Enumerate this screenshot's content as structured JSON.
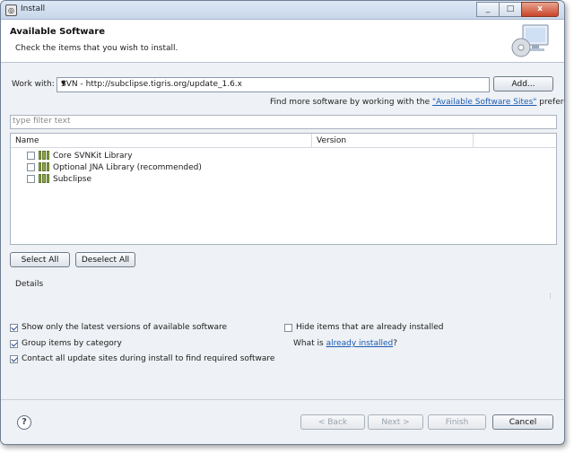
{
  "window": {
    "title": "Install",
    "icon": "eclipse-install-icon",
    "controls": {
      "minimize": "_",
      "maximize": "□",
      "close": "x"
    }
  },
  "header": {
    "title": "Available Software",
    "subtitle": "Check the items that you wish to install."
  },
  "work_with": {
    "label": "Work with:",
    "value": "SVN - http://subclipse.tigris.org/update_1.6.x",
    "add_label": "Add..."
  },
  "find_more": {
    "prefix": "Find more software by working with the ",
    "link": "\"Available Software Sites\"",
    "suffix": " preferences."
  },
  "filter": {
    "placeholder": "type filter text"
  },
  "tree": {
    "columns": [
      "Name",
      "Version"
    ],
    "items": [
      {
        "label": "Core SVNKit Library",
        "checked": false
      },
      {
        "label": "Optional JNA Library (recommended)",
        "checked": false
      },
      {
        "label": "Subclipse",
        "checked": false
      }
    ]
  },
  "selection": {
    "select_all": "Select All",
    "deselect_all": "Deselect All"
  },
  "details": {
    "label": "Details"
  },
  "options": {
    "latest_only": {
      "label": "Show only the latest versions of available software",
      "checked": true
    },
    "group_by_category": {
      "label": "Group items by category",
      "checked": true
    },
    "contact_sites": {
      "label": "Contact all update sites during install to find required software",
      "checked": true
    },
    "hide_installed": {
      "label": "Hide items that are already installed",
      "checked": false
    },
    "what_is": {
      "prefix": "What is ",
      "link": "already installed",
      "suffix": "?"
    }
  },
  "footer": {
    "back": "< Back",
    "next": "Next >",
    "finish": "Finish",
    "cancel": "Cancel"
  }
}
